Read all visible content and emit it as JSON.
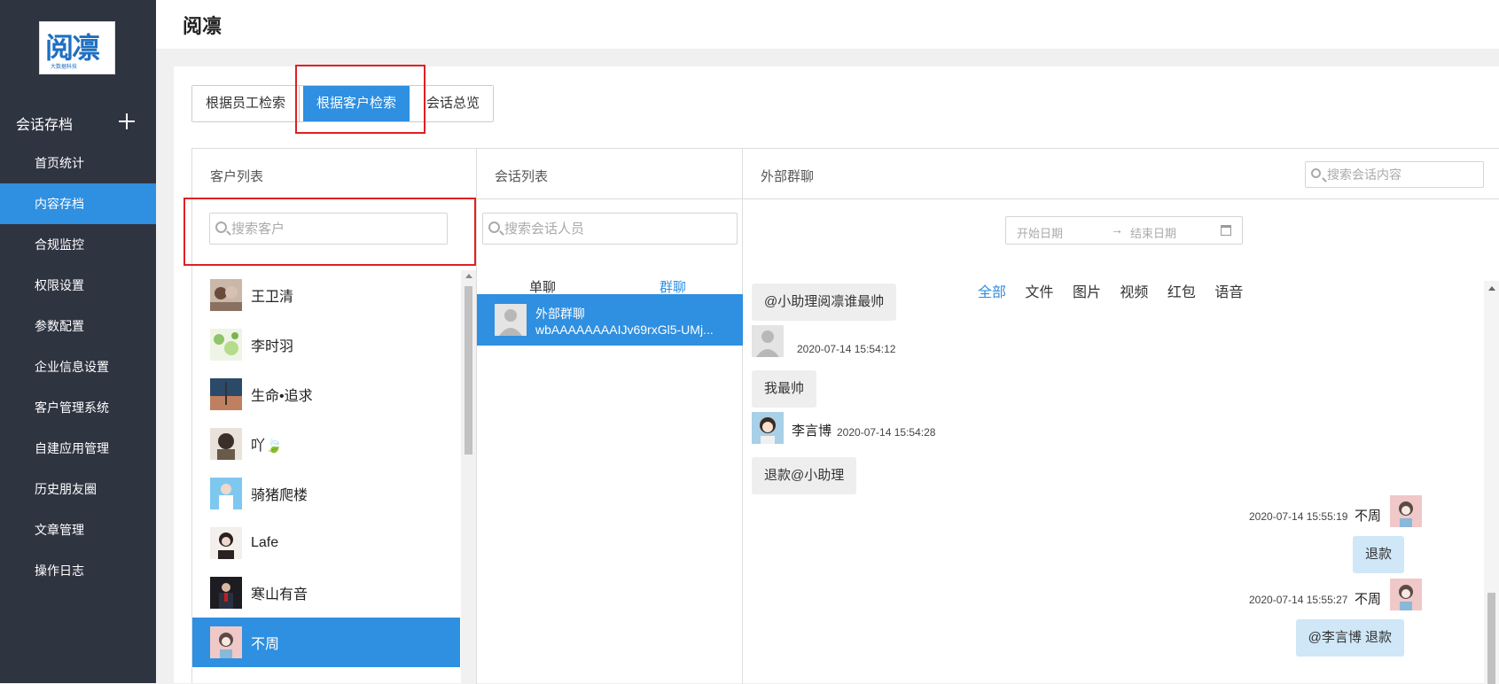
{
  "sidebar": {
    "logo_text": "阅凛",
    "logo_subtext": "大数据科技",
    "section_title": "会话存档",
    "items": [
      {
        "label": "首页统计",
        "active": false
      },
      {
        "label": "内容存档",
        "active": true
      },
      {
        "label": "合规监控",
        "active": false
      },
      {
        "label": "权限设置",
        "active": false
      },
      {
        "label": "参数配置",
        "active": false
      },
      {
        "label": "企业信息设置",
        "active": false
      },
      {
        "label": "客户管理系统",
        "active": false
      },
      {
        "label": "自建应用管理",
        "active": false
      },
      {
        "label": "历史朋友圈",
        "active": false
      },
      {
        "label": "文章管理",
        "active": false
      },
      {
        "label": "操作日志",
        "active": false
      }
    ]
  },
  "header": {
    "title": "阅凛"
  },
  "tabs": [
    {
      "label": "根据员工检索",
      "active": false
    },
    {
      "label": "根据客户检索",
      "active": true
    },
    {
      "label": "会话总览",
      "active": false
    }
  ],
  "customer_panel": {
    "title": "客户列表",
    "search_placeholder": "搜索客户",
    "customers": [
      {
        "name": "王卫清",
        "active": false
      },
      {
        "name": "李时羽",
        "active": false
      },
      {
        "name": "生命•追求",
        "active": false
      },
      {
        "name": "吖🍃",
        "active": false
      },
      {
        "name": "骑猪爬楼",
        "active": false
      },
      {
        "name": "Lafe",
        "active": false
      },
      {
        "name": "寒山有音",
        "active": false
      },
      {
        "name": "不周",
        "active": true
      }
    ]
  },
  "conversation_panel": {
    "title": "会话列表",
    "search_placeholder": "搜索会话人员",
    "type_tabs": [
      {
        "label": "单聊",
        "active": false
      },
      {
        "label": "群聊",
        "active": true
      }
    ],
    "conversations": [
      {
        "name": "外部群聊",
        "id": "wbAAAAAAAAIJv69rxGl5-UMj..."
      }
    ]
  },
  "chat_panel": {
    "title": "外部群聊",
    "search_placeholder": "搜索会话内容",
    "date_start_placeholder": "开始日期",
    "date_separator": "→",
    "date_end_placeholder": "结束日期",
    "filters": [
      {
        "label": "全部",
        "active": true
      },
      {
        "label": "文件",
        "active": false
      },
      {
        "label": "图片",
        "active": false
      },
      {
        "label": "视频",
        "active": false
      },
      {
        "label": "红包",
        "active": false
      },
      {
        "label": "语音",
        "active": false
      }
    ],
    "messages": [
      {
        "text": "@小助理阅凛谁最帅"
      },
      {
        "time": "2020-07-14 15:54:12",
        "text": "我最帅"
      },
      {
        "sender": "李言博",
        "time": "2020-07-14 15:54:28",
        "text": "退款@小助理"
      },
      {
        "sender": "不周",
        "time": "2020-07-14 15:55:19",
        "text": "退款"
      },
      {
        "sender": "不周",
        "time": "2020-07-14 15:55:27",
        "text": "@李言博 退款"
      }
    ]
  },
  "colors": {
    "accent": "#2f8fe0",
    "sidebar_bg": "#2f3441",
    "highlight": "#e02020"
  }
}
